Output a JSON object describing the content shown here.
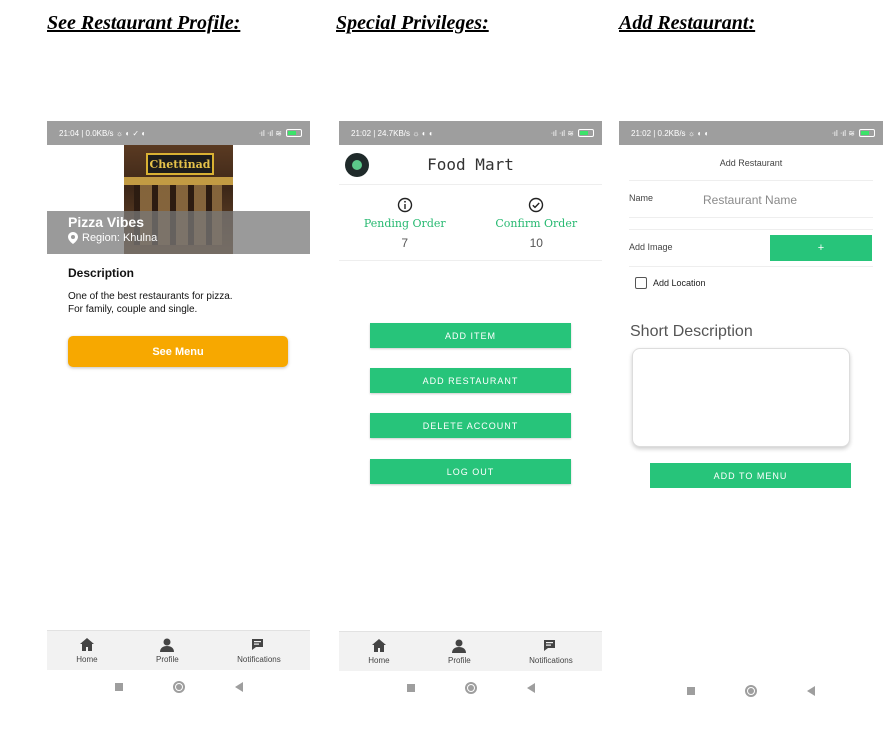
{
  "headings": {
    "profile": "See Restaurant Profile:",
    "privileges": "Special Privileges:",
    "add": "Add Restaurant:"
  },
  "colors": {
    "status_bar": "#9e9e9e",
    "accent_orange": "#f7a800",
    "accent_green": "#27c47a",
    "green_text": "#27b971"
  },
  "screen1": {
    "status_left": "21:04 | 0.0KB/s ☼ ◐ ✓ ◐",
    "status_right": "ᐧıl ᐧıl ≋",
    "restaurant_name": "Pizza Vibes",
    "photo_sign": "Chettinad",
    "region": "Region: Khulna",
    "description_title": "Description",
    "description_text": "One of the best restaurants for pizza.\nFor family, couple and single.",
    "see_menu": "See Menu"
  },
  "screen2": {
    "status_left": "21:02 | 24.7KB/s ☼ ◐ ◐",
    "status_right": "ᐧıl ᐧıl ≋",
    "app_title": "Food Mart",
    "pending_label": "Pending Order",
    "pending_value": "7",
    "confirm_label": "Confirm Order",
    "confirm_value": "10",
    "buttons": [
      "ADD ITEM",
      "ADD RESTAURANT",
      "DELETE ACCOUNT",
      "LOG OUT"
    ]
  },
  "screen3": {
    "status_left": "21:02 | 0.2KB/s ☼ ◐ ◐",
    "status_right": "ᐧıl ᐧıl ≋",
    "title": "Add Restaurant",
    "name_label": "Name",
    "name_placeholder": "Restaurant Name",
    "image_label": "Add Image",
    "plus": "+",
    "location_label": "Add Location",
    "short_description": "Short Description",
    "add_to_menu": "ADD TO MENU"
  },
  "bottom_nav": {
    "home": "Home",
    "profile": "Profile",
    "notifications": "Notifications"
  }
}
